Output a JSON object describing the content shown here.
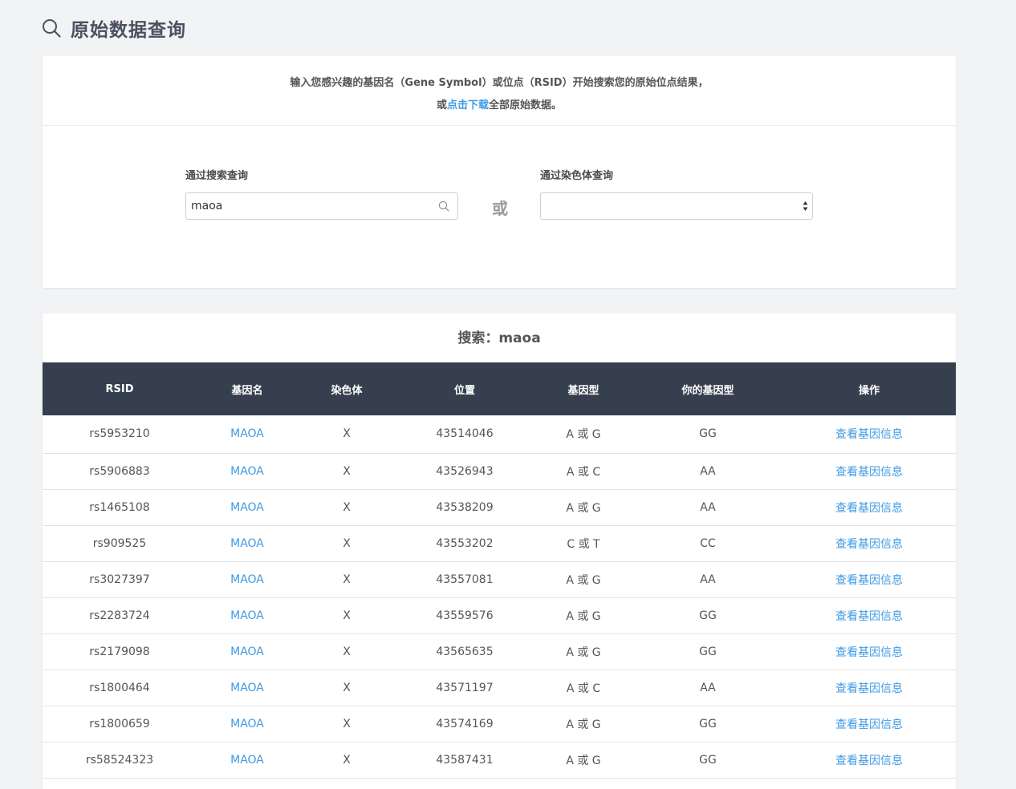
{
  "header": {
    "title": "原始数据查询"
  },
  "intro": {
    "line1": "输入您感兴趣的基因名（Gene Symbol）或位点（RSID）开始搜索您的原始位点结果，",
    "line2_prefix": "或",
    "line2_link": "点击下载",
    "line2_suffix": "全部原始数据。"
  },
  "search_form": {
    "search_label": "通过搜索查询",
    "search_value": "maoa",
    "or_label": "或",
    "chromosome_label": "通过染色体查询",
    "chromosome_value": ""
  },
  "results": {
    "title_prefix": "搜索：",
    "keyword": "maoa",
    "columns": [
      "RSID",
      "基因名",
      "染色体",
      "位置",
      "基因型",
      "你的基因型",
      "操作"
    ],
    "rows": [
      {
        "rsid": "rs5953210",
        "gene": "MAOA",
        "chromosome": "X",
        "position": "43514046",
        "genotype": "A 或 G",
        "your_genotype": "GG",
        "action": "查看基因信息"
      },
      {
        "rsid": "rs5906883",
        "gene": "MAOA",
        "chromosome": "X",
        "position": "43526943",
        "genotype": "A 或 C",
        "your_genotype": "AA",
        "action": "查看基因信息"
      },
      {
        "rsid": "rs1465108",
        "gene": "MAOA",
        "chromosome": "X",
        "position": "43538209",
        "genotype": "A 或 G",
        "your_genotype": "AA",
        "action": "查看基因信息"
      },
      {
        "rsid": "rs909525",
        "gene": "MAOA",
        "chromosome": "X",
        "position": "43553202",
        "genotype": "C 或 T",
        "your_genotype": "CC",
        "action": "查看基因信息"
      },
      {
        "rsid": "rs3027397",
        "gene": "MAOA",
        "chromosome": "X",
        "position": "43557081",
        "genotype": "A 或 G",
        "your_genotype": "AA",
        "action": "查看基因信息"
      },
      {
        "rsid": "rs2283724",
        "gene": "MAOA",
        "chromosome": "X",
        "position": "43559576",
        "genotype": "A 或 G",
        "your_genotype": "GG",
        "action": "查看基因信息"
      },
      {
        "rsid": "rs2179098",
        "gene": "MAOA",
        "chromosome": "X",
        "position": "43565635",
        "genotype": "A 或 G",
        "your_genotype": "GG",
        "action": "查看基因信息"
      },
      {
        "rsid": "rs1800464",
        "gene": "MAOA",
        "chromosome": "X",
        "position": "43571197",
        "genotype": "A 或 C",
        "your_genotype": "AA",
        "action": "查看基因信息"
      },
      {
        "rsid": "rs1800659",
        "gene": "MAOA",
        "chromosome": "X",
        "position": "43574169",
        "genotype": "A 或 G",
        "your_genotype": "GG",
        "action": "查看基因信息"
      },
      {
        "rsid": "rs58524323",
        "gene": "MAOA",
        "chromosome": "X",
        "position": "43587431",
        "genotype": "A 或 G",
        "your_genotype": "GG",
        "action": "查看基因信息"
      }
    ]
  },
  "colors": {
    "link": "#3f9ae5",
    "table_header_bg": "#353f4e",
    "page_bg": "#f2f3f5"
  },
  "icons": {
    "header": "search-icon",
    "search_input": "search-icon",
    "select": "select-arrows-icon"
  }
}
